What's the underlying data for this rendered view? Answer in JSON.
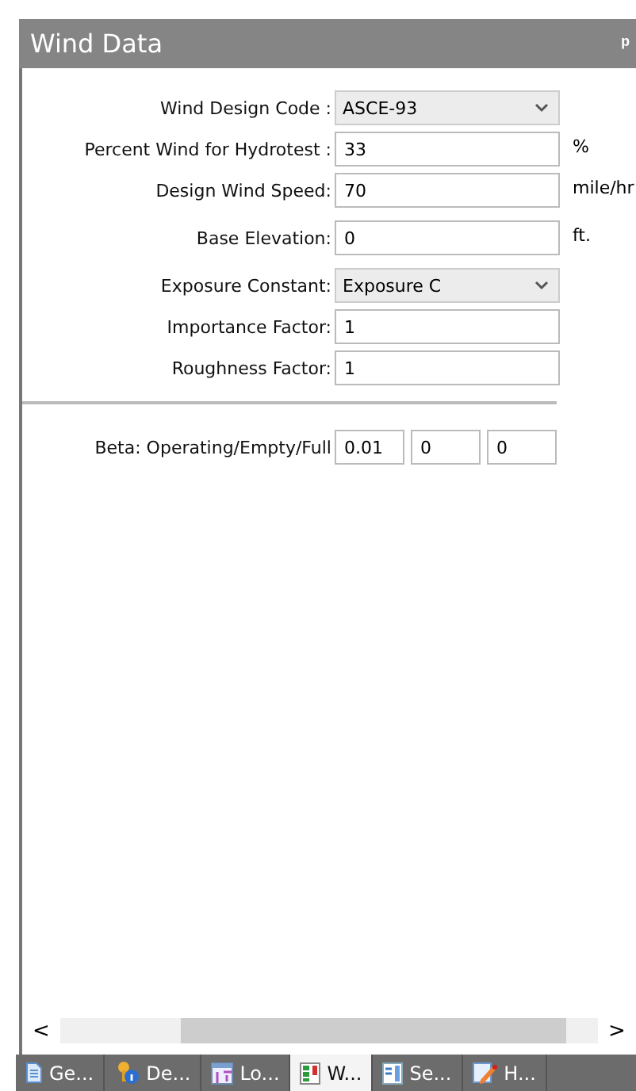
{
  "panel": {
    "title": "Wind Data",
    "pin": "ᵖ"
  },
  "fields": [
    {
      "kind": "select",
      "label": "Wind Design Code :",
      "value": "ASCE-93"
    },
    {
      "kind": "input",
      "label": "Percent Wind for Hydrotest :",
      "value": "33",
      "unit": "%"
    },
    {
      "kind": "input",
      "label": "Design Wind Speed:",
      "value": "70",
      "unit": "mile/hr"
    },
    {
      "kind": "input",
      "label": "Base Elevation:",
      "value": "0",
      "unit": "ft."
    },
    {
      "kind": "select",
      "label": "Exposure Constant:",
      "value": "Exposure C"
    },
    {
      "kind": "input",
      "label": "Importance Factor:",
      "value": "1"
    },
    {
      "kind": "input",
      "label": "Roughness Factor:",
      "value": "1"
    }
  ],
  "beta": {
    "label": "Beta: Operating/Empty/Full",
    "values": [
      "0.01",
      "0",
      "0"
    ]
  },
  "scrollbar": {
    "left": "<",
    "right": ">"
  },
  "tabs": [
    {
      "kind": "page",
      "label": "Ge...",
      "selected": false
    },
    {
      "kind": "key",
      "label": "De...",
      "selected": false
    },
    {
      "kind": "grid",
      "label": "Lo...",
      "selected": false
    },
    {
      "kind": "bars",
      "label": "W...",
      "selected": true
    },
    {
      "kind": "list",
      "label": "Se...",
      "selected": false
    },
    {
      "kind": "edit",
      "label": "H...",
      "selected": false
    }
  ]
}
